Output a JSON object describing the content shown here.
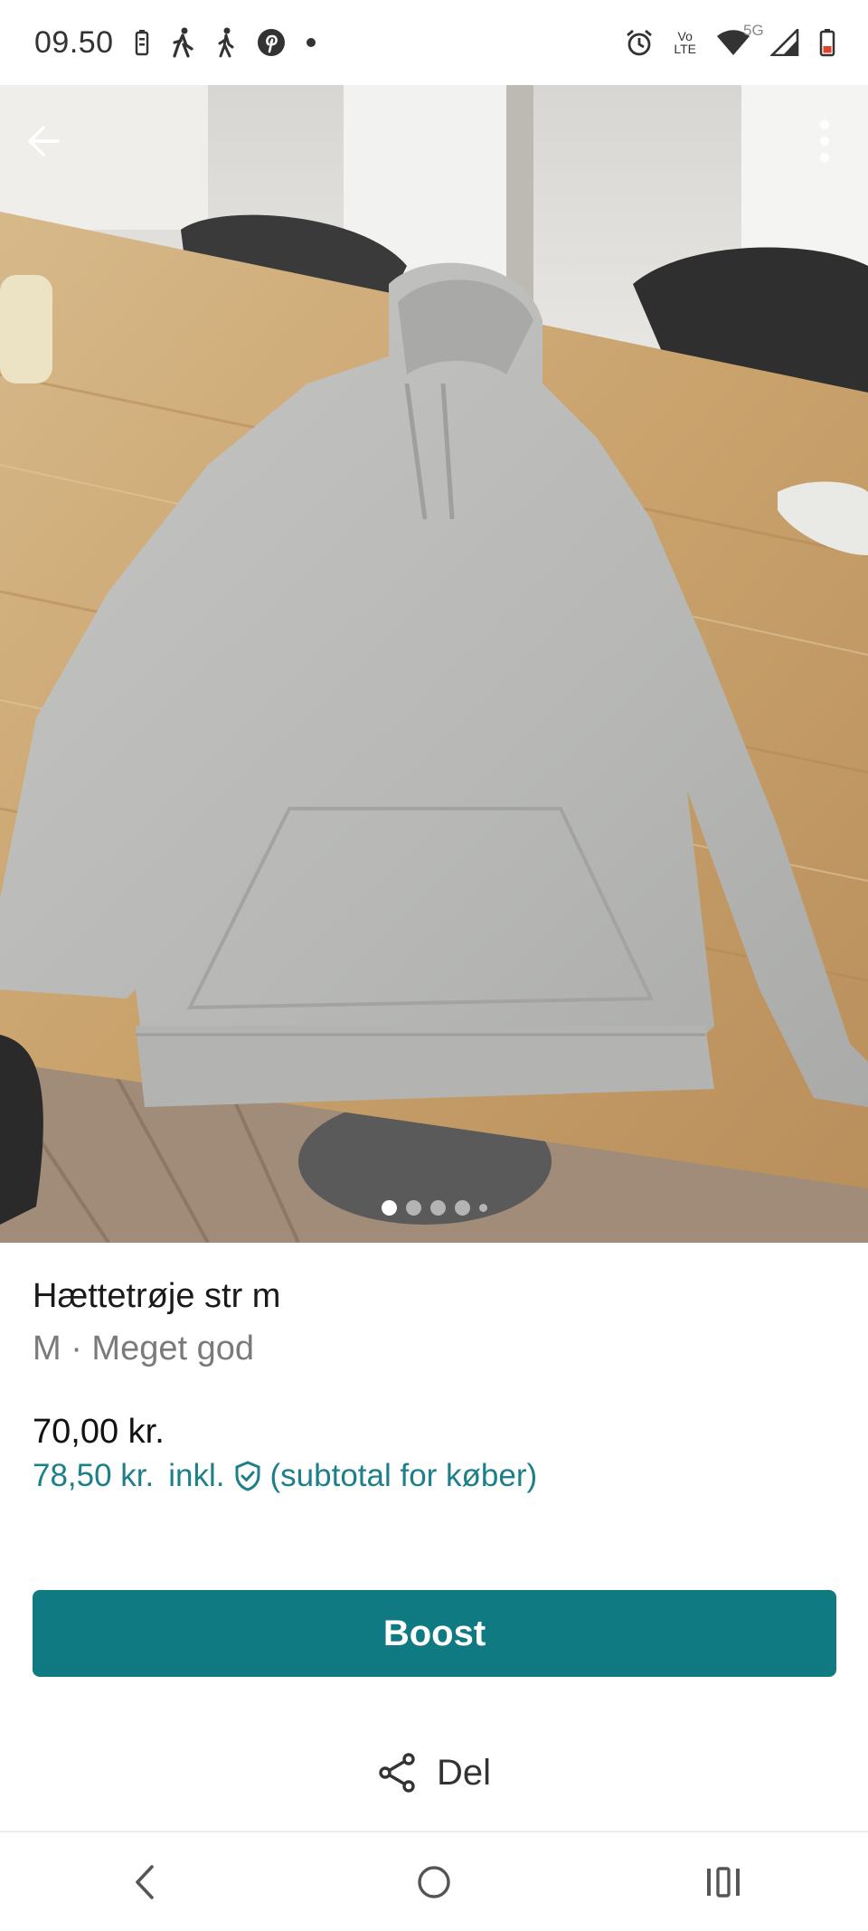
{
  "status_bar": {
    "time": "09.50",
    "network": "5G",
    "volte_label": "Vo",
    "lte_label": "LTE"
  },
  "listing": {
    "photo_indicator": {
      "count": 5,
      "active_index": 0
    },
    "title": "Hættetrøje str m",
    "subtitle": "M · Meget god",
    "price": "70,00 kr.",
    "buyer_total": "78,50 kr.",
    "buyer_incl": "inkl.",
    "buyer_note": "(subtotal for køber)"
  },
  "actions": {
    "boost_label": "Boost",
    "share_label": "Del"
  },
  "colors": {
    "accent": "#0f7a82",
    "teal_text": "#1d7f88"
  },
  "icons": {
    "back": "back-arrow-icon",
    "more": "more-vert-icon",
    "share": "share-icon",
    "shield": "shield-check-icon"
  }
}
